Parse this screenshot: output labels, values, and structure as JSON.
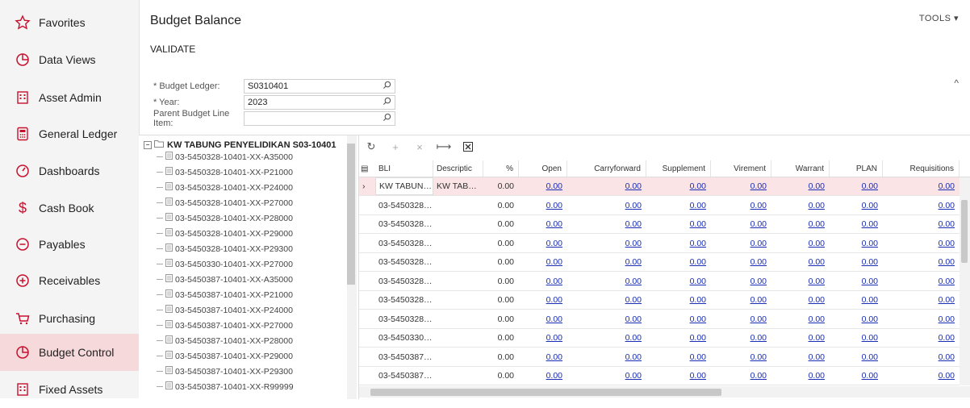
{
  "sidebar": {
    "items": [
      {
        "label": "Favorites",
        "icon": "star-icon",
        "active": false
      },
      {
        "label": "Data Views",
        "icon": "pie-chart-icon",
        "active": false
      },
      {
        "label": "Asset Admin",
        "icon": "building-icon",
        "active": false
      },
      {
        "label": "General Ledger",
        "icon": "calculator-icon",
        "active": false
      },
      {
        "label": "Dashboards",
        "icon": "gauge-icon",
        "active": false
      },
      {
        "label": "Cash Book",
        "icon": "dollar-icon",
        "active": false
      },
      {
        "label": "Payables",
        "icon": "minus-circle-icon",
        "active": false
      },
      {
        "label": "Receivables",
        "icon": "plus-circle-icon",
        "active": false
      },
      {
        "label": "Purchasing",
        "icon": "cart-icon",
        "active": false
      },
      {
        "label": "Budget Control",
        "icon": "pie-chart-icon",
        "active": true
      },
      {
        "label": "Fixed Assets",
        "icon": "building-icon",
        "active": false
      }
    ]
  },
  "header": {
    "title": "Budget Balance",
    "tools_label": "TOOLS ▾",
    "validate_label": "VALIDATE"
  },
  "form": {
    "budget_ledger_label": "* Budget Ledger:",
    "budget_ledger_value": "S0310401",
    "year_label": "* Year:",
    "year_value": "2023",
    "parent_label": "Parent Budget Line Item:",
    "parent_value": ""
  },
  "tree": {
    "root": "KW TABUNG PENYELIDIKAN S03-10401",
    "items": [
      "03-5450328-10401-XX-A35000",
      "03-5450328-10401-XX-P21000",
      "03-5450328-10401-XX-P24000",
      "03-5450328-10401-XX-P27000",
      "03-5450328-10401-XX-P28000",
      "03-5450328-10401-XX-P29000",
      "03-5450328-10401-XX-P29300",
      "03-5450330-10401-XX-P27000",
      "03-5450387-10401-XX-A35000",
      "03-5450387-10401-XX-P21000",
      "03-5450387-10401-XX-P24000",
      "03-5450387-10401-XX-P27000",
      "03-5450387-10401-XX-P28000",
      "03-5450387-10401-XX-P29000",
      "03-5450387-10401-XX-P29300",
      "03-5450387-10401-XX-R99999"
    ]
  },
  "grid": {
    "columns": [
      "BLI",
      "Descriptic",
      "%",
      "Open",
      "Carryforward",
      "Supplement",
      "Virement",
      "Warrant",
      "PLAN",
      "Requisitions"
    ],
    "rows": [
      {
        "bli": "KW TABUN…",
        "desc": "KW TAB…",
        "pct": "0.00",
        "open": "0.00",
        "carry": "0.00",
        "supp": "0.00",
        "vir": "0.00",
        "warr": "0.00",
        "plan": "0.00",
        "req": "0.00"
      },
      {
        "bli": "03-5450328…",
        "desc": "",
        "pct": "0.00",
        "open": "0.00",
        "carry": "0.00",
        "supp": "0.00",
        "vir": "0.00",
        "warr": "0.00",
        "plan": "0.00",
        "req": "0.00"
      },
      {
        "bli": "03-5450328…",
        "desc": "",
        "pct": "0.00",
        "open": "0.00",
        "carry": "0.00",
        "supp": "0.00",
        "vir": "0.00",
        "warr": "0.00",
        "plan": "0.00",
        "req": "0.00"
      },
      {
        "bli": "03-5450328…",
        "desc": "",
        "pct": "0.00",
        "open": "0.00",
        "carry": "0.00",
        "supp": "0.00",
        "vir": "0.00",
        "warr": "0.00",
        "plan": "0.00",
        "req": "0.00"
      },
      {
        "bli": "03-5450328…",
        "desc": "",
        "pct": "0.00",
        "open": "0.00",
        "carry": "0.00",
        "supp": "0.00",
        "vir": "0.00",
        "warr": "0.00",
        "plan": "0.00",
        "req": "0.00"
      },
      {
        "bli": "03-5450328…",
        "desc": "",
        "pct": "0.00",
        "open": "0.00",
        "carry": "0.00",
        "supp": "0.00",
        "vir": "0.00",
        "warr": "0.00",
        "plan": "0.00",
        "req": "0.00"
      },
      {
        "bli": "03-5450328…",
        "desc": "",
        "pct": "0.00",
        "open": "0.00",
        "carry": "0.00",
        "supp": "0.00",
        "vir": "0.00",
        "warr": "0.00",
        "plan": "0.00",
        "req": "0.00"
      },
      {
        "bli": "03-5450328…",
        "desc": "",
        "pct": "0.00",
        "open": "0.00",
        "carry": "0.00",
        "supp": "0.00",
        "vir": "0.00",
        "warr": "0.00",
        "plan": "0.00",
        "req": "0.00"
      },
      {
        "bli": "03-5450330…",
        "desc": "",
        "pct": "0.00",
        "open": "0.00",
        "carry": "0.00",
        "supp": "0.00",
        "vir": "0.00",
        "warr": "0.00",
        "plan": "0.00",
        "req": "0.00"
      },
      {
        "bli": "03-5450387…",
        "desc": "",
        "pct": "0.00",
        "open": "0.00",
        "carry": "0.00",
        "supp": "0.00",
        "vir": "0.00",
        "warr": "0.00",
        "plan": "0.00",
        "req": "0.00"
      },
      {
        "bli": "03-5450387…",
        "desc": "",
        "pct": "0.00",
        "open": "0.00",
        "carry": "0.00",
        "supp": "0.00",
        "vir": "0.00",
        "warr": "0.00",
        "plan": "0.00",
        "req": "0.00"
      }
    ]
  },
  "colors": {
    "accent": "#c8102e",
    "active_bg": "#f6d9db",
    "link": "#1a2eb5"
  }
}
